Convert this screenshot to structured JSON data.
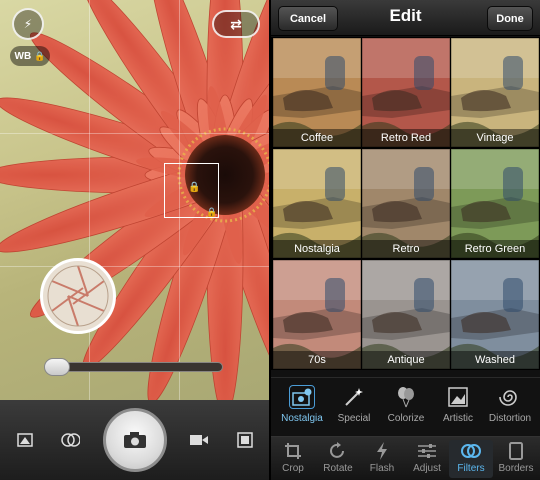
{
  "camera": {
    "wb_label": "WB",
    "flash_icon": "flash-icon",
    "flip_icon": "flip-camera-icon",
    "bottom_icons": [
      "image-mode-icon",
      "lens-icon",
      "shutter-icon",
      "video-icon",
      "gallery-icon"
    ],
    "zoom_level": 0
  },
  "edit": {
    "title": "Edit",
    "cancel_label": "Cancel",
    "done_label": "Done",
    "filters": [
      {
        "label": "Coffee",
        "tone": "#b98a55"
      },
      {
        "label": "Retro Red",
        "tone": "#b3574a"
      },
      {
        "label": "Vintage",
        "tone": "#c9b47d"
      },
      {
        "label": "Nostalgia",
        "tone": "#c8b06a"
      },
      {
        "label": "Retro",
        "tone": "#a0876a"
      },
      {
        "label": "Retro Green",
        "tone": "#7d9a58"
      },
      {
        "label": "70s",
        "tone": "#c28a7a"
      },
      {
        "label": "Antique",
        "tone": "#9a9490"
      },
      {
        "label": "Washed",
        "tone": "#7f8e9e"
      }
    ],
    "tools": [
      {
        "label": "Nostalgia",
        "icon": "photo-plus-icon",
        "active": true
      },
      {
        "label": "Special",
        "icon": "magic-wand-icon",
        "active": false
      },
      {
        "label": "Colorize",
        "icon": "balloons-icon",
        "active": false
      },
      {
        "label": "Artistic",
        "icon": "picture-frame-icon",
        "active": false
      },
      {
        "label": "Distortion",
        "icon": "swirl-icon",
        "active": false
      }
    ],
    "tabs": [
      {
        "label": "Crop",
        "icon": "crop-icon",
        "active": false
      },
      {
        "label": "Rotate",
        "icon": "rotate-icon",
        "active": false
      },
      {
        "label": "Flash",
        "icon": "flash-icon",
        "active": false
      },
      {
        "label": "Adjust",
        "icon": "sliders-icon",
        "active": false
      },
      {
        "label": "Filters",
        "icon": "filters-icon",
        "active": true
      },
      {
        "label": "Borders",
        "icon": "borders-icon",
        "active": false
      }
    ]
  }
}
